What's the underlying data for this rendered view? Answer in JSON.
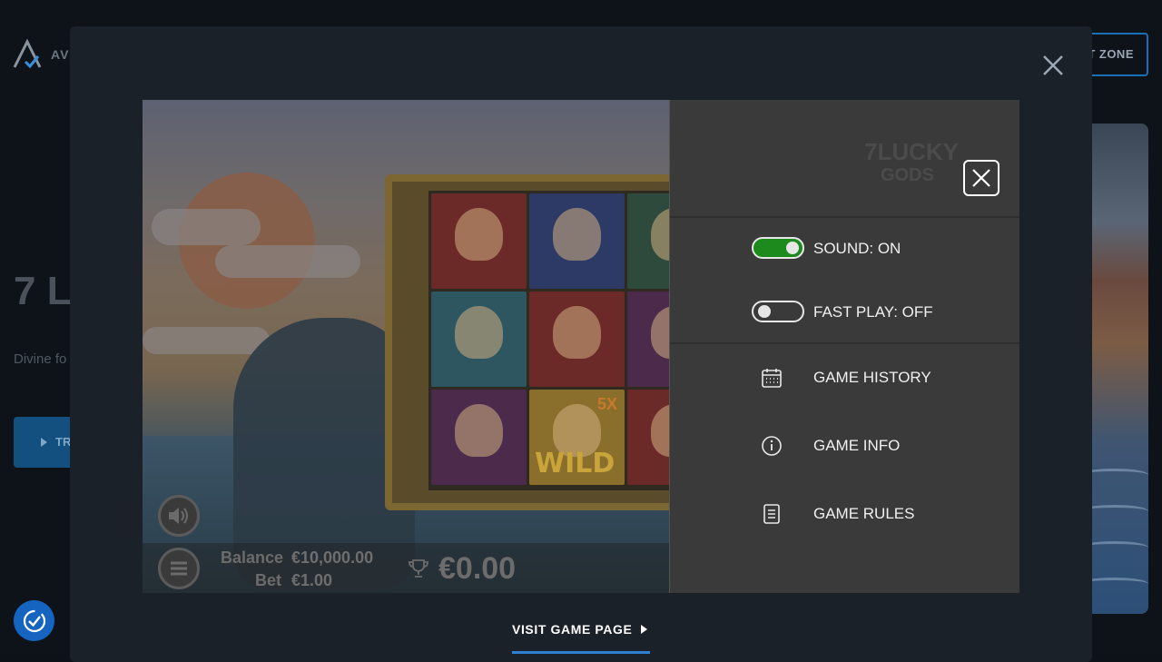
{
  "background": {
    "brand": "AV",
    "top_button": "T ZONE",
    "title": "7 L",
    "subtitle": "Divine fo",
    "try_button": "TR"
  },
  "game": {
    "balance_label": "Balance",
    "balance_value": "€10,000.00",
    "bet_label": "Bet",
    "bet_value": "€1.00",
    "win_value": "€0.00",
    "wild_label": "WILD",
    "multiplier": "5X",
    "logo_text_1": "7LUCKY",
    "logo_text_2": "GODS"
  },
  "settings": {
    "sound_label": "SOUND: ON",
    "sound_on": true,
    "fastplay_label": "FAST PLAY: OFF",
    "fastplay_on": false,
    "menu": [
      {
        "label": "GAME HISTORY",
        "icon": "calendar-icon"
      },
      {
        "label": "GAME INFO",
        "icon": "info-icon"
      },
      {
        "label": "GAME RULES",
        "icon": "document-icon"
      }
    ]
  },
  "footer": {
    "visit_label": "VISIT GAME PAGE"
  },
  "colors": {
    "toggle_on": "#1d8a1d",
    "accent_blue": "#2f80d0",
    "modal_bg": "#1b2129"
  }
}
